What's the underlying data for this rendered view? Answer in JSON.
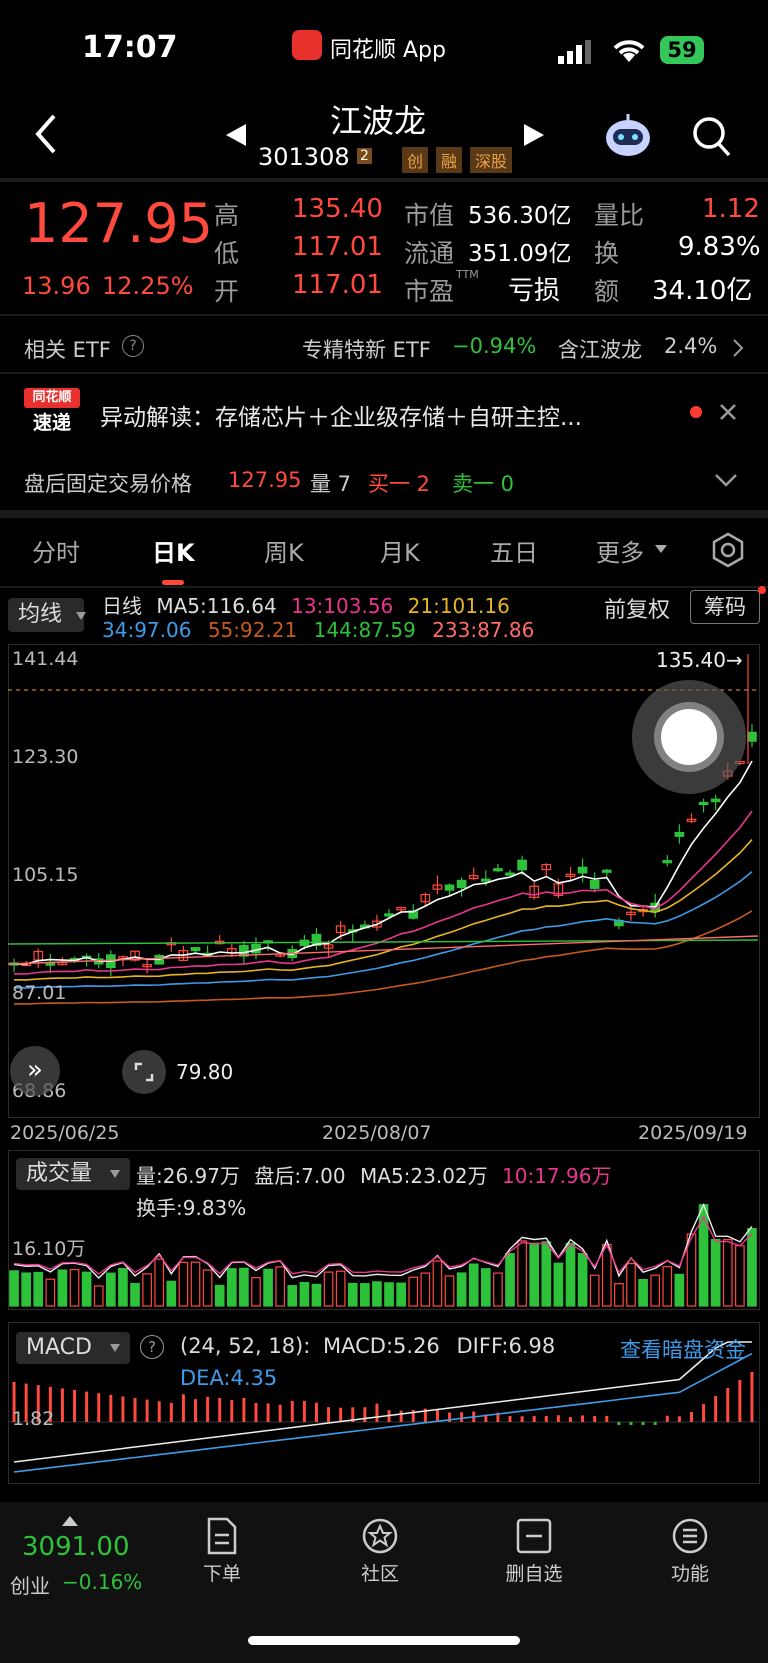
{
  "status": {
    "time": "17:07",
    "app": "同花顺 App",
    "battery": "59"
  },
  "header": {
    "name": "江波龙",
    "code": "301308",
    "code_sup": "2",
    "tags": [
      "创",
      "融",
      "深股"
    ]
  },
  "quote": {
    "price": "127.95",
    "change": "13.96",
    "change_pct": "12.25%",
    "high_label": "高",
    "high": "135.40",
    "low_label": "低",
    "low": "117.01",
    "open_label": "开",
    "open": "117.01",
    "mcap_label": "市值",
    "mcap": "536.30亿",
    "float_label": "流通",
    "float": "351.09亿",
    "pe_label": "市盈",
    "pe_sup": "TTM",
    "pe": "亏损",
    "vol_ratio_label": "量比",
    "vol_ratio": "1.12",
    "turnover_label": "换",
    "turnover": "9.83%",
    "amount_label": "额",
    "amount": "34.10亿"
  },
  "etf": {
    "label": "相关 ETF",
    "name": "专精特新 ETF",
    "change": "−0.94%",
    "contains": "含江波龙",
    "weight": "2.4%"
  },
  "news": {
    "logo_top": "同花顺",
    "logo_bottom": "速递",
    "text": "异动解读：存储芯片＋企业级存储＋自研主控..."
  },
  "after_hours": {
    "label": "盘后固定交易价格",
    "price": "127.95",
    "vol": "量 7",
    "buy": "买一 2",
    "sell": "卖一 0"
  },
  "tabs": [
    "分时",
    "日K",
    "周K",
    "月K",
    "五日",
    "更多"
  ],
  "active_tab": "日K",
  "ma_legend": {
    "selector": "均线",
    "adj": "前复权",
    "chips": "筹码",
    "line1": [
      {
        "t": "日线",
        "c": "#dddddd"
      },
      {
        "t": "MA5:116.64",
        "c": "#dddddd"
      },
      {
        "t": "13:103.56",
        "c": "#e8368f"
      },
      {
        "t": "21:101.16",
        "c": "#e6b422"
      }
    ],
    "line2": [
      {
        "t": "34:97.06",
        "c": "#3f9be8"
      },
      {
        "t": "55:92.21",
        "c": "#c65a1e"
      },
      {
        "t": "144:87.59",
        "c": "#2ec23a"
      },
      {
        "t": "233:87.86",
        "c": "#ff6b6b"
      }
    ]
  },
  "price_axis": [
    "141.44",
    "123.30",
    "105.15",
    "87.01",
    "68.86"
  ],
  "high_marker": "135.40→",
  "low_marker": "79.80",
  "dates": [
    "2025/06/25",
    "2025/08/07",
    "2025/09/19"
  ],
  "volume": {
    "selector": "成交量",
    "line1": [
      {
        "t": "量:26.97万",
        "c": "#dddddd"
      },
      {
        "t": "盘后:7.00",
        "c": "#dddddd"
      },
      {
        "t": "MA5:23.02万",
        "c": "#dddddd"
      },
      {
        "t": "10:17.96万",
        "c": "#e8368f"
      }
    ],
    "turnover": "换手:9.83%",
    "axis": "16.10万"
  },
  "macd": {
    "selector": "MACD",
    "params": "(24, 52, 18):",
    "macd": "MACD:5.26",
    "diff": "DIFF:6.98",
    "dea": "DEA:4.35",
    "dark_pool": "查看暗盘资金",
    "axis": "1.82"
  },
  "bottom": {
    "index_value": "3091.00",
    "index_name": "创业",
    "index_change": "−0.16%",
    "items": [
      "下单",
      "社区",
      "删自选",
      "功能"
    ]
  },
  "colors": {
    "up": "#ff4a3d",
    "down": "#2ec23a",
    "ma5": "#ffffff",
    "ma13": "#e8368f",
    "ma21": "#e6b422",
    "ma34": "#3f9be8",
    "ma55": "#c65a1e",
    "ma144": "#2ec23a",
    "ma233": "#ff6b6b",
    "link": "#3f9be8"
  }
}
